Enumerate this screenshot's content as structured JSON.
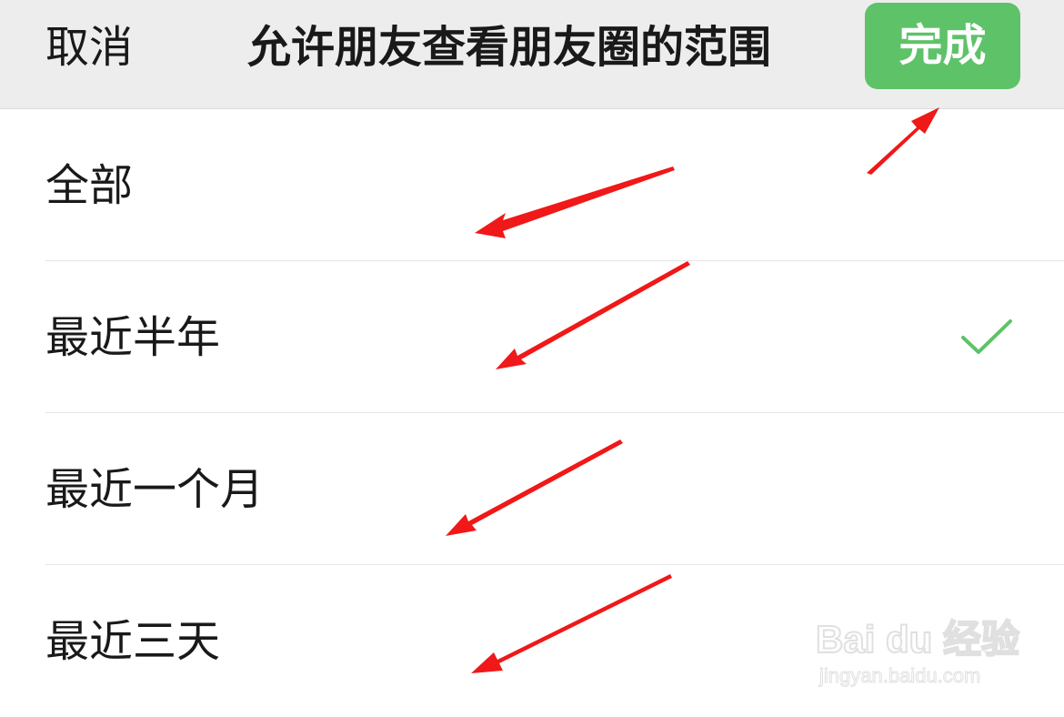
{
  "nav": {
    "cancel_label": "取消",
    "title": "允许朋友查看朋友圈的范围",
    "done_label": "完成"
  },
  "options": [
    {
      "label": "全部",
      "selected": false
    },
    {
      "label": "最近半年",
      "selected": true
    },
    {
      "label": "最近一个月",
      "selected": false
    },
    {
      "label": "最近三天",
      "selected": false
    }
  ],
  "icons": {
    "selected_check": "checkmark-icon"
  },
  "watermark": {
    "logo_text": "Bai du 经验",
    "url_text": "jingyan.baidu.com"
  },
  "colors": {
    "nav_background": "#ededed",
    "done_button": "#5ec269",
    "check": "#5ec269",
    "annotation_arrow": "#f01818"
  }
}
